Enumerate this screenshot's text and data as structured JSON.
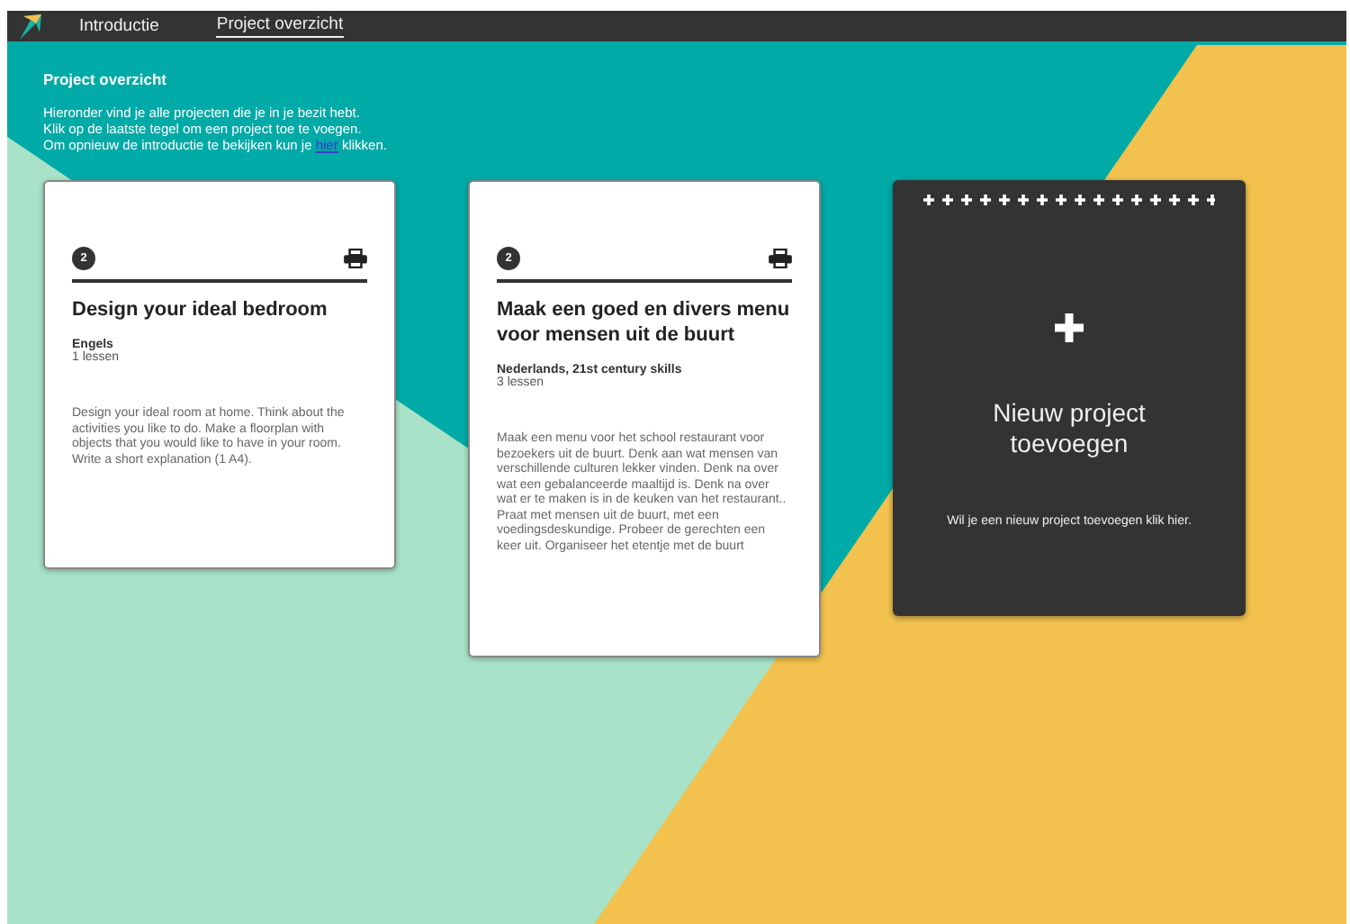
{
  "nav": {
    "items": [
      {
        "label": "Introductie",
        "selected": false
      },
      {
        "label": "Project overzicht",
        "selected": true
      }
    ]
  },
  "overview": {
    "title": "Project overzicht",
    "intro": [
      "Hieronder vind je alle projecten die je in je bezit hebt.",
      "Klik op de laatste tegel om een project toe te voegen."
    ],
    "intro_link_line": {
      "before": "Om opnieuw de introductie te bekijken kun je",
      "link": "hier",
      "after": "klikken."
    }
  },
  "projects": [
    {
      "number": "2",
      "title": "Design your ideal bedroom",
      "subjects": "Engels",
      "lessons": "1 lessen",
      "description": "Design your ideal room at home. Think about the activities you like to do. Make a floorplan with objects that you would like to have in your room. Write a short explanation (1 A4)."
    },
    {
      "number": "2",
      "title": "Maak een goed en divers menu voor mensen uit de buurt",
      "subjects": "Nederlands, 21st century skills",
      "lessons": "3 lessen",
      "description": "Maak een menu voor het school restaurant voor bezoekers uit de buurt. Denk aan wat mensen van verschillende culturen lekker vinden. Denk na over wat een gebalanceerde maaltijd is. Denk na over wat er te maken is in de keuken van het restaurant.. Praat met mensen uit de buurt, met een voedingsdeskundige. Probeer de gerechten een keer uit. Organiseer het etentje met de buurt"
    }
  ],
  "new_project": {
    "title": "Nieuw project toevoegen",
    "text": "Wil je een nieuw project toevoegen klik hier."
  }
}
